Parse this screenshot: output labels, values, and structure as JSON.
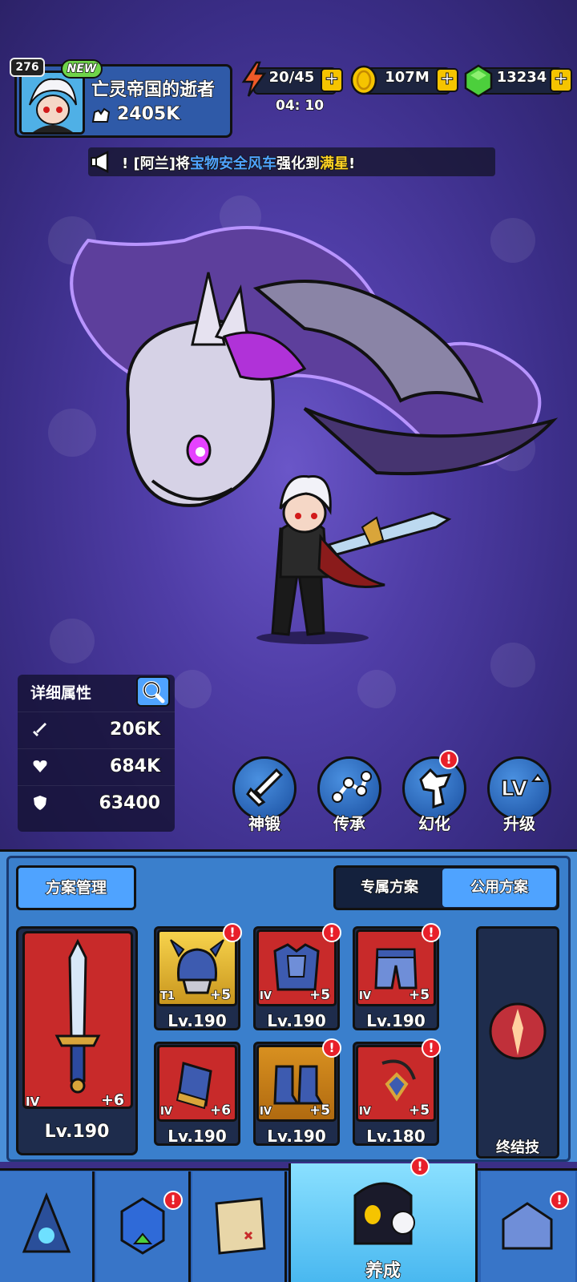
{
  "player": {
    "level": "276",
    "new_badge": "NEW",
    "name": "亡灵帝国的逝者",
    "power": "2405K"
  },
  "resources": {
    "stamina": "20/45",
    "stamina_timer": "04: 10",
    "gold": "107M",
    "gems": "13234",
    "plus_label": "+"
  },
  "broadcast": {
    "prefix": "!",
    "player": "[阿兰]",
    "verb1": "将",
    "item": "宝物安全风车",
    "verb2": "强化到",
    "result": "满星",
    "suffix": "!"
  },
  "stats": {
    "title": "详细属性",
    "attack": "206K",
    "hp": "684K",
    "defense": "63400"
  },
  "actions": [
    {
      "label": "神锻",
      "icon": "sword-icon",
      "alert": false
    },
    {
      "label": "传承",
      "icon": "nodes-icon",
      "alert": false
    },
    {
      "label": "幻化",
      "icon": "dragon-icon",
      "alert": true
    },
    {
      "label": "升级",
      "icon": "levelup-icon",
      "alert": true
    }
  ],
  "gear_panel": {
    "plan_manage": "方案管理",
    "tab_exclusive": "专属方案",
    "tab_public": "公用方案",
    "weapon": {
      "tier": "IV",
      "plus": "+6",
      "level": "Lv.190"
    },
    "slots": [
      {
        "tier": "T1",
        "plus": "+5",
        "level": "Lv.190",
        "style": "gold",
        "icon": "helmet-icon"
      },
      {
        "tier": "IV",
        "plus": "+5",
        "level": "Lv.190",
        "style": "red",
        "icon": "chest-armor-icon"
      },
      {
        "tier": "IV",
        "plus": "+5",
        "level": "Lv.190",
        "style": "red",
        "icon": "leg-armor-icon"
      },
      {
        "tier": "IV",
        "plus": "+6",
        "level": "Lv.190",
        "style": "red",
        "icon": "bracer-icon"
      },
      {
        "tier": "IV",
        "plus": "+5",
        "level": "Lv.190",
        "style": "orange",
        "icon": "boots-icon"
      },
      {
        "tier": "IV",
        "plus": "+5",
        "level": "Lv.180",
        "style": "red",
        "icon": "amulet-icon"
      }
    ],
    "finisher_label": "终结技"
  },
  "nav": {
    "active_label": "养成"
  },
  "alert_mark": "!",
  "colors": {
    "accent": "#4fa3ff",
    "alert": "#e8202a",
    "gold": "#f5c400",
    "panel": "#3a7fcc"
  }
}
